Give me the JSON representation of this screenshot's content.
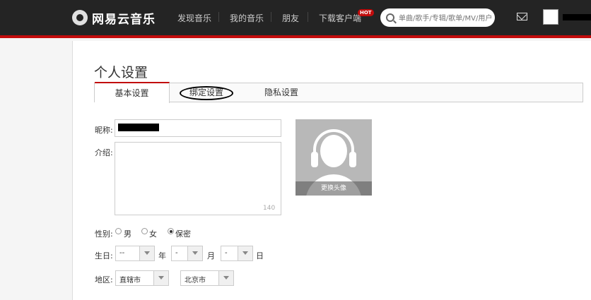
{
  "header": {
    "brand": "网易云音乐",
    "nav": [
      "发现音乐",
      "我的音乐",
      "朋友",
      "下载客户端"
    ],
    "hot_badge": "HOT",
    "search_placeholder": "单曲/歌手/专辑/歌单/MV/用户"
  },
  "page": {
    "title": "个人设置",
    "tabs": [
      "基本设置",
      "绑定设置",
      "隐私设置"
    ]
  },
  "form": {
    "nickname_label": "昵称:",
    "intro_label": "介绍:",
    "intro_counter": "140",
    "change_avatar": "更换头像",
    "gender_label": "性别:",
    "gender_options": [
      "男",
      "女",
      "保密"
    ],
    "gender_selected": "保密",
    "birthday_label": "生日:",
    "year_value": "--",
    "year_unit": "年",
    "month_value": "-",
    "month_unit": "月",
    "day_value": "-",
    "day_unit": "日",
    "region_label": "地区:",
    "province": "直辖市",
    "city": "北京市"
  },
  "colors": {
    "accent": "#c20c0c",
    "topbar": "#242424"
  }
}
